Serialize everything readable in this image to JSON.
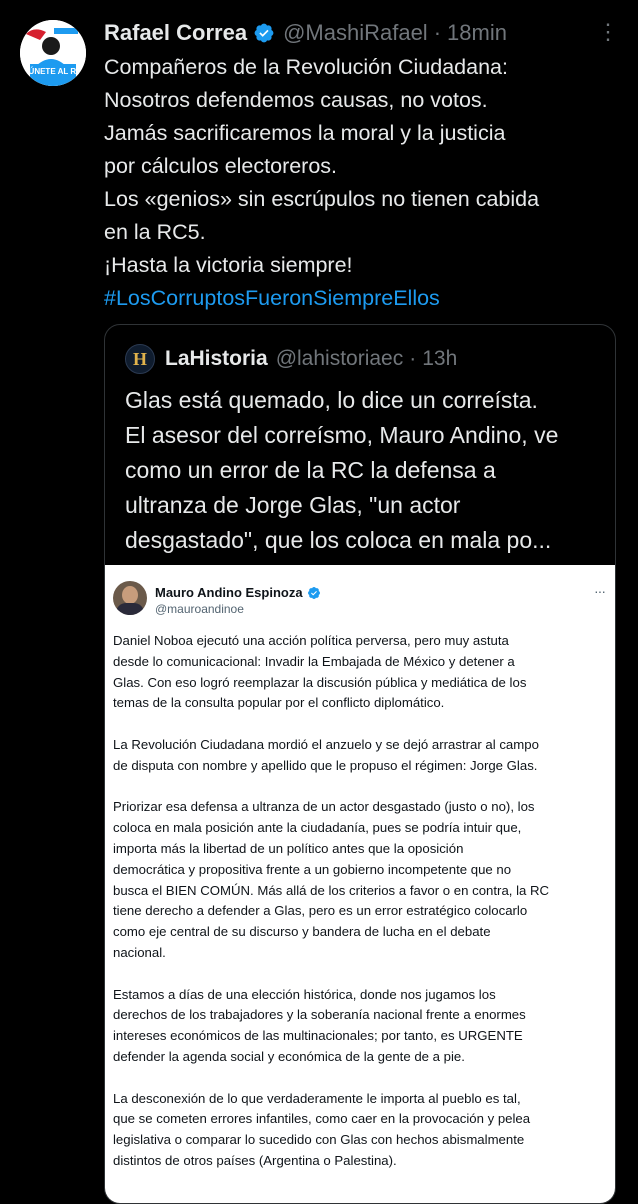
{
  "tweet": {
    "display_name": "Rafael Correa",
    "handle": "@MashiRafael",
    "separator": "·",
    "time": "18min",
    "avatar_text": "#ÚNETE AL RC",
    "more": "⋮",
    "body_lines": [
      "Compañeros de la Revolución Ciudadana:",
      "Nosotros defendemos causas, no votos.",
      "Jamás sacrificaremos la moral y la justicia",
      "por cálculos electoreros.",
      "Los «genios» sin escrúpulos no tienen cabida",
      "en la RC5.",
      "¡Hasta la victoria siempre!"
    ],
    "hashtag": "#LosCorruptosFueronSiempreEllos"
  },
  "quote": {
    "avatar_letter": "H",
    "display_name": "LaHistoria",
    "handle": "@lahistoriaec",
    "separator": "·",
    "time": "13h",
    "body_lines": [
      "Glas está quemado, lo dice un correísta.",
      "El asesor del correísmo, Mauro Andino, ve",
      "como un error de la RC la defensa a",
      "ultranza de Jorge Glas, \"un actor",
      "desgastado\", que los coloca en mala po..."
    ]
  },
  "screenshot": {
    "display_name": "Mauro Andino Espinoza",
    "handle": "@mauroandinoe",
    "more": "···",
    "paragraphs": [
      [
        "Daniel Noboa ejecutó una acción política perversa, pero muy astuta",
        "desde lo comunicacional: Invadir la Embajada de México y detener a",
        "Glas. Con eso logró reemplazar la discusión pública y mediática de los",
        "temas de la consulta popular por el conflicto diplomático."
      ],
      [
        "La Revolución Ciudadana mordió el anzuelo y se dejó arrastrar al campo",
        "de disputa con nombre y apellido que le propuso el régimen: Jorge Glas."
      ],
      [
        "Priorizar esa defensa a ultranza de un actor desgastado (justo o no), los",
        "coloca en mala posición ante la ciudadanía, pues se podría intuir que,",
        "importa más la libertad de un político antes que la oposición",
        "democrática y propositiva frente a un gobierno incompetente que no",
        "busca el BIEN COMÚN. Más allá de los criterios a favor o en contra, la RC",
        "tiene derecho a defender a Glas, pero es un error estratégico colocarlo",
        "como eje central de su discurso y bandera de lucha en el debate",
        "nacional."
      ],
      [
        "Estamos a días de una elección histórica, donde nos jugamos los",
        "derechos de los trabajadores y la soberanía nacional frente a enormes",
        "intereses económicos de las multinacionales; por tanto, es URGENTE",
        "defender la agenda social y económica de la gente de a pie."
      ],
      [
        "La desconexión de lo que verdaderamente le importa al pueblo es tal,",
        "que se cometen errores infantiles, como caer en la provocación y pelea",
        "legislativa o comparar lo sucedido con Glas con hechos abismalmente",
        "distintos de otros países (Argentina o Palestina)."
      ]
    ]
  },
  "colors": {
    "background": "#000000",
    "text": "#e7e9ea",
    "muted": "#71767b",
    "link": "#1d9bf0",
    "border": "#2f3336"
  },
  "icons": [
    "verified-badge-icon",
    "more-options-icon"
  ]
}
